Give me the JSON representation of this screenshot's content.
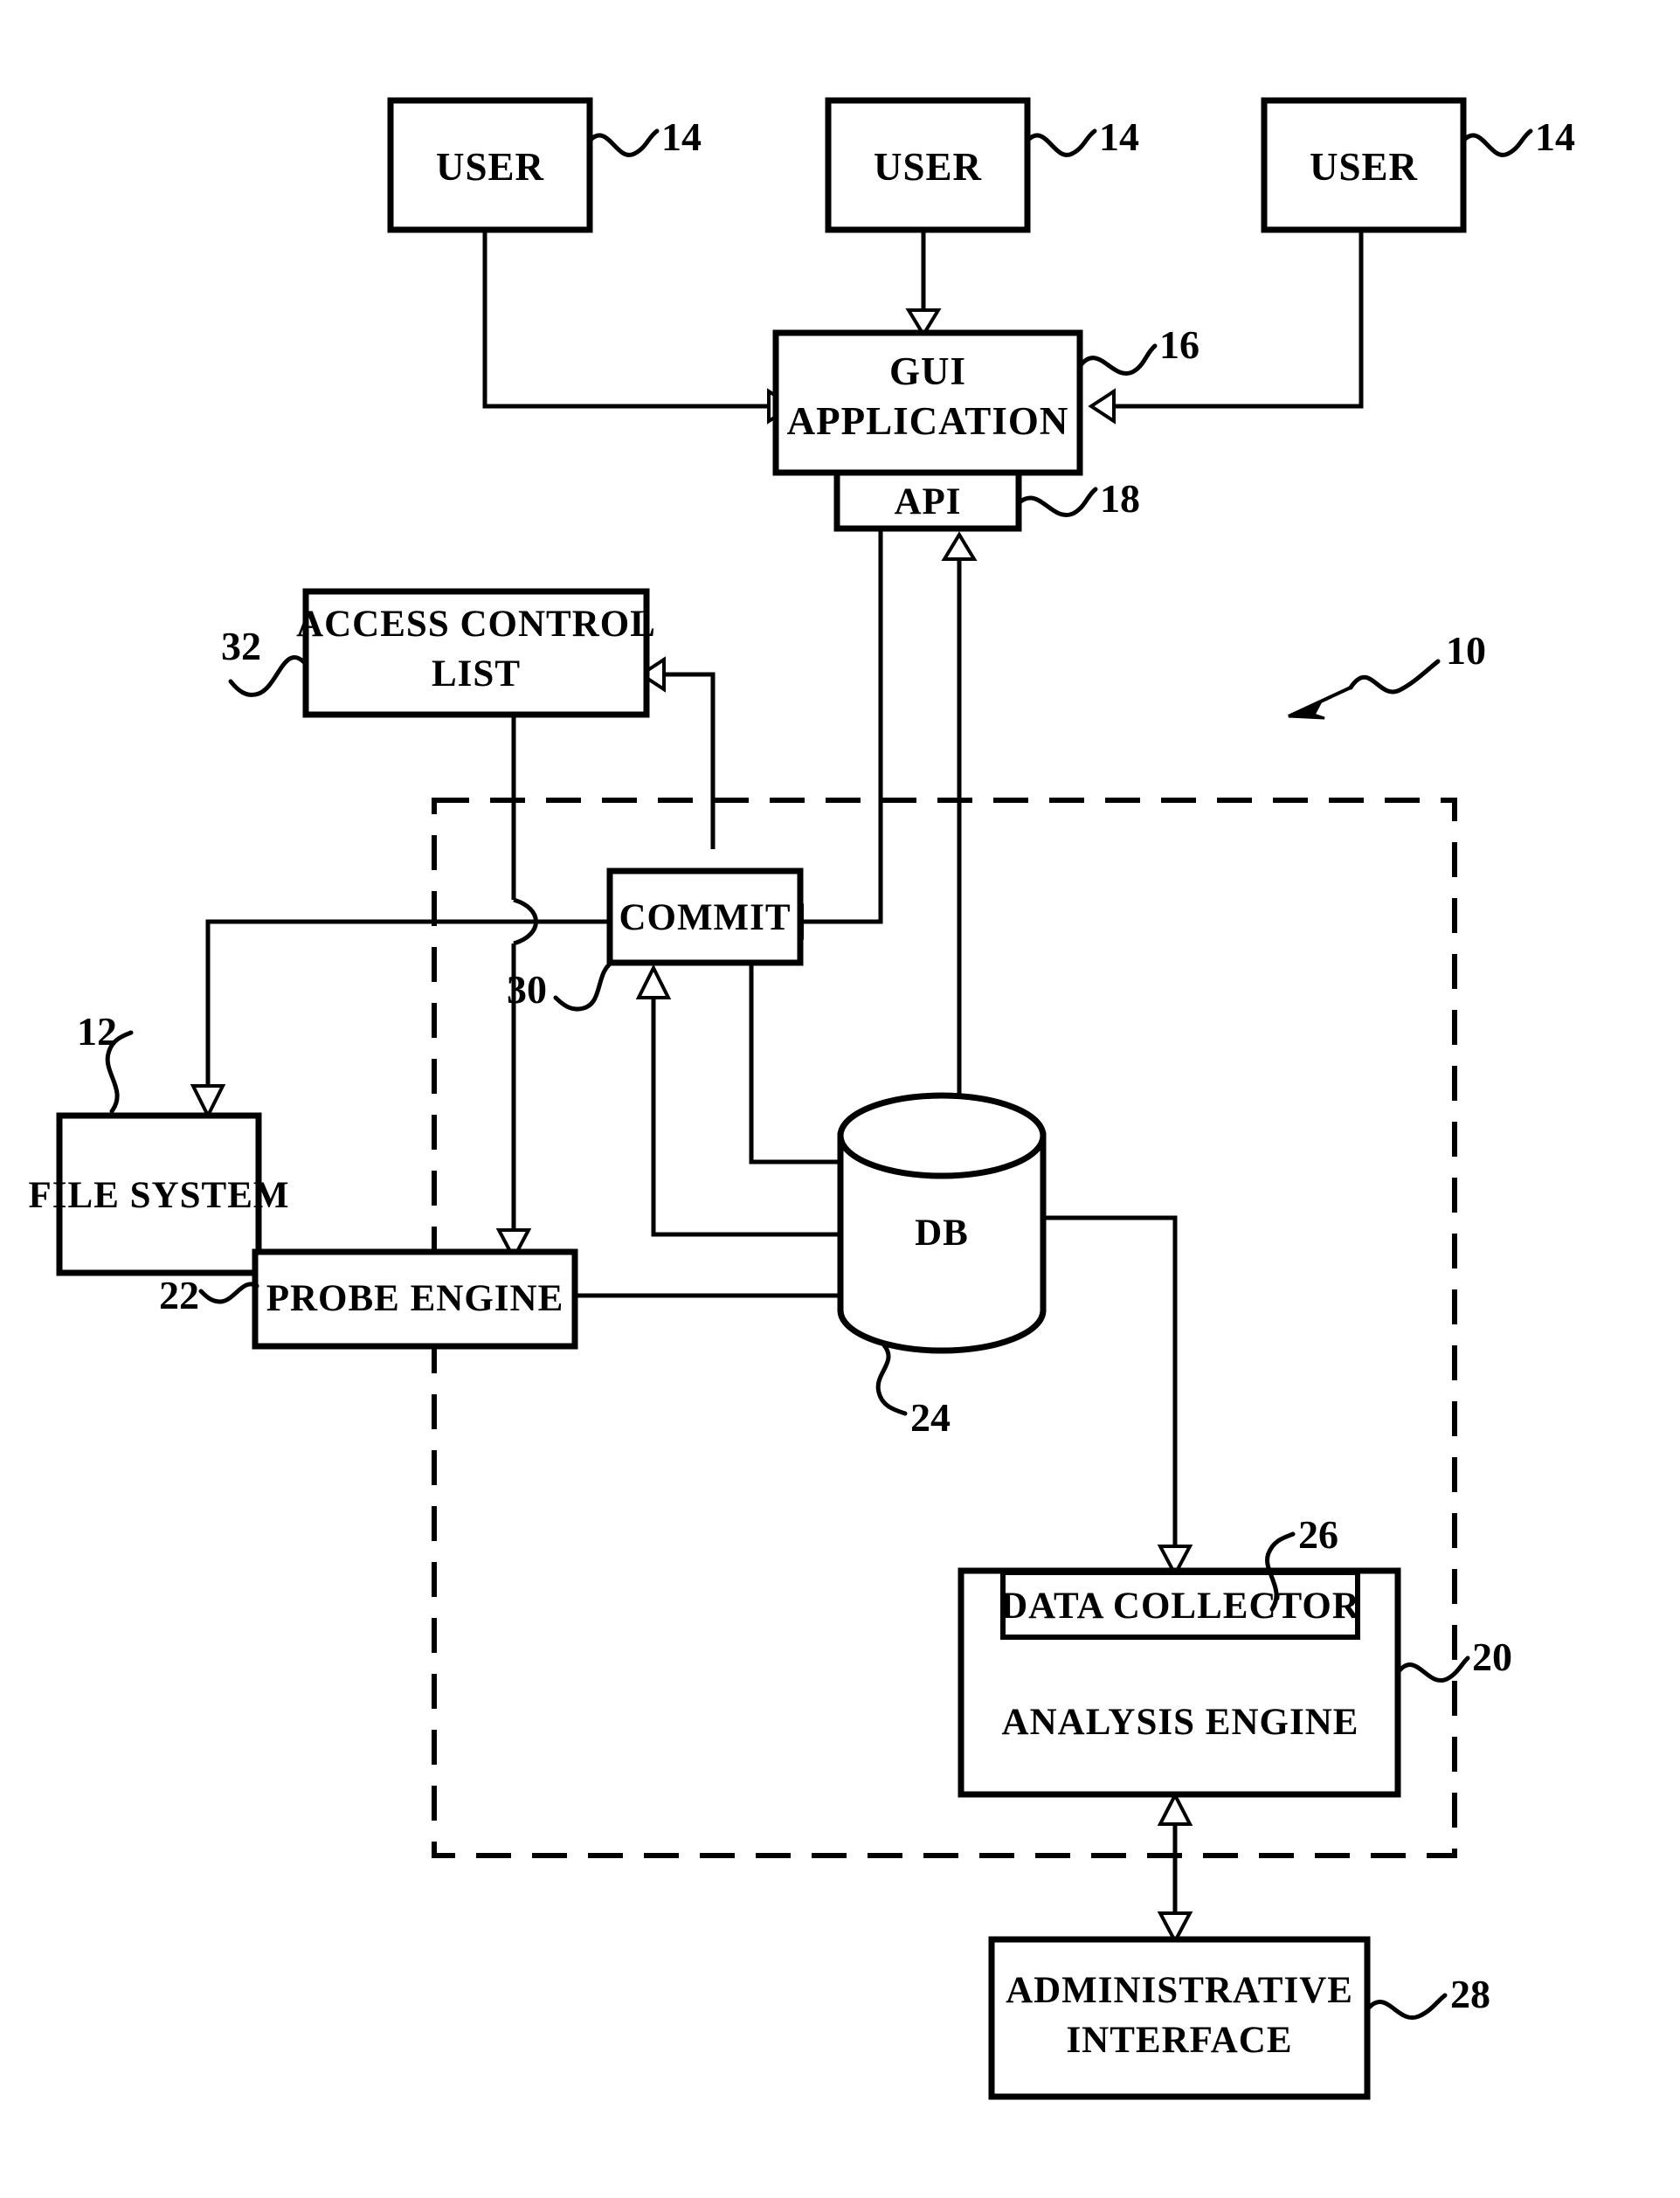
{
  "figure": {
    "title": "System block diagram",
    "background_color": "#ffffff",
    "line_color": "#000000"
  },
  "nodes": {
    "user_1": {
      "label": "USER",
      "ref": "14"
    },
    "user_2": {
      "label": "USER",
      "ref": "14"
    },
    "user_3": {
      "label": "USER",
      "ref": "14"
    },
    "gui_application": {
      "label_line1": "GUI",
      "label_line2": "APPLICATION",
      "ref": "16"
    },
    "api": {
      "label": "API",
      "ref": "18"
    },
    "access_control_list": {
      "label_line1": "ACCESS CONTROL",
      "label_line2": "LIST",
      "ref": "32"
    },
    "commit": {
      "label": "COMMIT",
      "ref": "30"
    },
    "file_system": {
      "label": "FILE SYSTEM",
      "ref": "12"
    },
    "probe_engine": {
      "label": "PROBE ENGINE",
      "ref": "22"
    },
    "db": {
      "label": "DB",
      "ref": "24"
    },
    "data_collector": {
      "label": "DATA COLLECTOR",
      "ref": "26"
    },
    "analysis_engine": {
      "label": "ANALYSIS ENGINE",
      "ref": "20"
    },
    "administrative_interface": {
      "label_line1": "ADMINISTRATIVE",
      "label_line2": "INTERFACE",
      "ref": "28"
    },
    "system_boundary": {
      "label": "",
      "ref": "10"
    }
  },
  "reference_numerals": [
    {
      "id": "10",
      "value": "10",
      "points_to": "system-boundary"
    },
    {
      "id": "12",
      "value": "12",
      "points_to": "file-system"
    },
    {
      "id": "14a",
      "value": "14",
      "points_to": "user-1"
    },
    {
      "id": "14b",
      "value": "14",
      "points_to": "user-2"
    },
    {
      "id": "14c",
      "value": "14",
      "points_to": "user-3"
    },
    {
      "id": "16",
      "value": "16",
      "points_to": "gui-application"
    },
    {
      "id": "18",
      "value": "18",
      "points_to": "api"
    },
    {
      "id": "20",
      "value": "20",
      "points_to": "analysis-engine"
    },
    {
      "id": "22",
      "value": "22",
      "points_to": "probe-engine"
    },
    {
      "id": "24",
      "value": "24",
      "points_to": "db"
    },
    {
      "id": "26",
      "value": "26",
      "points_to": "data-collector"
    },
    {
      "id": "28",
      "value": "28",
      "points_to": "administrative-interface"
    },
    {
      "id": "30",
      "value": "30",
      "points_to": "commit"
    },
    {
      "id": "32",
      "value": "32",
      "points_to": "access-control-list"
    }
  ]
}
